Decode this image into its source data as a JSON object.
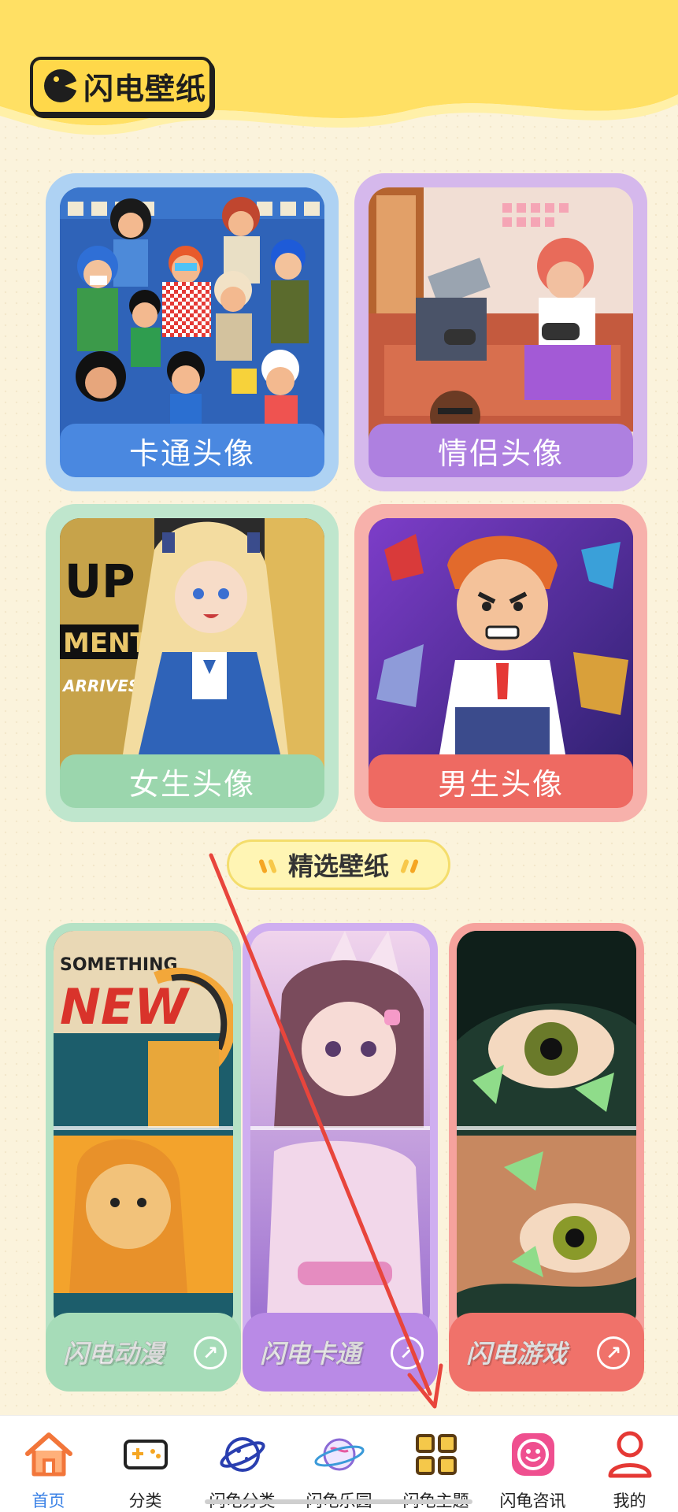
{
  "app": {
    "brand": "闪电壁纸"
  },
  "categories": [
    {
      "id": "cartoon",
      "label": "卡通头像"
    },
    {
      "id": "couple",
      "label": "情侣头像"
    },
    {
      "id": "girl",
      "label": "女生头像"
    },
    {
      "id": "boy",
      "label": "男生头像"
    }
  ],
  "section": {
    "title": "精选壁纸"
  },
  "featured": [
    {
      "id": "anime",
      "label": "闪电动漫",
      "poster_text_1": "SOMETHING",
      "poster_text_2": "NEW"
    },
    {
      "id": "cartoon",
      "label": "闪电卡通"
    },
    {
      "id": "game",
      "label": "闪电游戏"
    }
  ],
  "art_text": {
    "girl_poster_1": "UP",
    "girl_poster_2": "MENT",
    "girl_poster_3": "ARRIVES!"
  },
  "tabbar": {
    "active": "首页",
    "items": [
      {
        "label": "首页",
        "icon": "home-icon"
      },
      {
        "label": "分类",
        "icon": "gamepad-icon"
      },
      {
        "label": "闪龟分类",
        "icon": "planet-icon"
      },
      {
        "label": "闪龟乐园",
        "icon": "globe-ring-icon"
      },
      {
        "label": "闪龟主题",
        "icon": "grid-icon"
      },
      {
        "label": "闪龟咨讯",
        "icon": "smile-icon"
      },
      {
        "label": "我的",
        "icon": "user-icon"
      }
    ]
  },
  "colors": {
    "accent_blue": "#4a88e0",
    "accent_purple": "#ae80e0",
    "accent_green": "#9bd6ad",
    "accent_red": "#ee6a62",
    "tab_active": "#3b82e6",
    "annotation_arrow": "#e8453c"
  }
}
